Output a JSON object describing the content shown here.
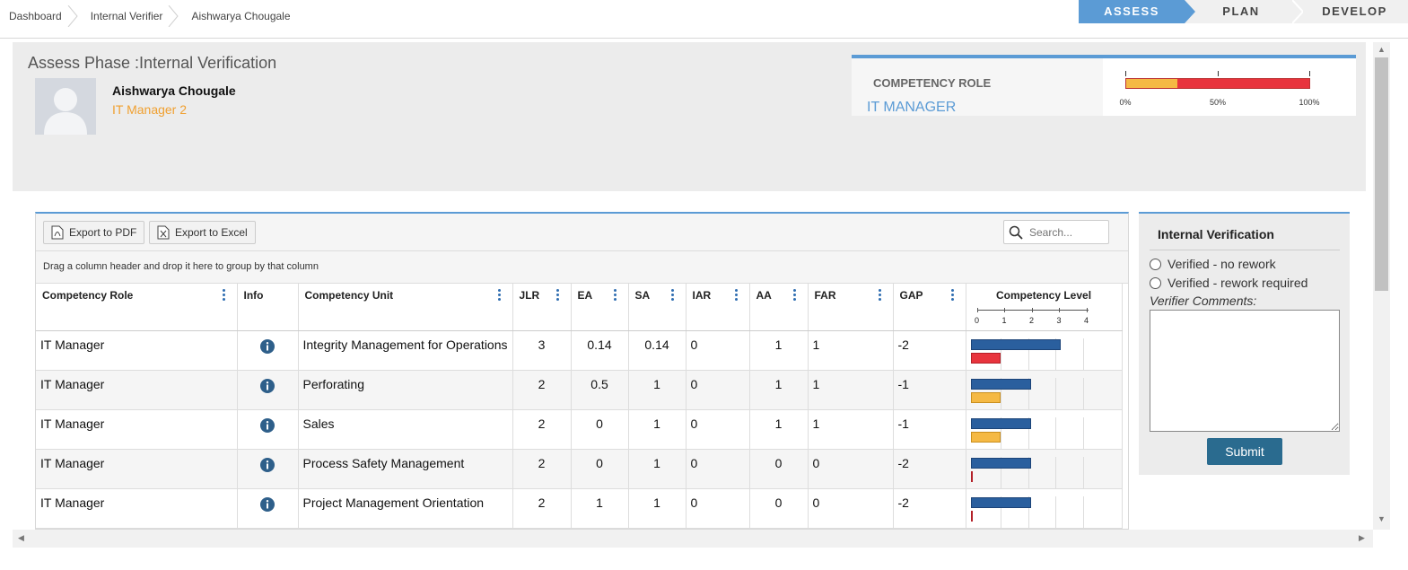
{
  "breadcrumb": [
    "Dashboard",
    "Internal Verifier",
    "Aishwarya Chougale"
  ],
  "phases": [
    {
      "label": "ASSESS",
      "active": true
    },
    {
      "label": "PLAN",
      "active": false
    },
    {
      "label": "DEVELOP",
      "active": false
    }
  ],
  "header": {
    "phase_title": "Assess Phase :Internal Verification",
    "user_name": "Aishwarya Chougale",
    "user_role": "IT Manager 2",
    "avatar_icon": "user-silhouette-icon"
  },
  "competency_card": {
    "label": "COMPETENCY ROLE",
    "value": "IT MANAGER",
    "progress_fraction": 0.28,
    "ticks": [
      "0%",
      "50%",
      "100%"
    ]
  },
  "toolbar": {
    "export_pdf": "Export to PDF",
    "export_excel": "Export to Excel",
    "search_placeholder": "Search..."
  },
  "grouping_hint": "Drag a column header and drop it here to group by that column",
  "columns": [
    "Competency Role",
    "Info",
    "Competency Unit",
    "JLR",
    "EA",
    "SA",
    "IAR",
    "AA",
    "FAR",
    "GAP",
    "Competency Level"
  ],
  "level_scale": [
    "0",
    "1",
    "2",
    "3",
    "4"
  ],
  "rows": [
    {
      "role": "IT Manager",
      "unit": "Integrity Management for Operations",
      "jlr": "3",
      "ea": "0.14",
      "sa": "0.14",
      "iar": "0",
      "aa": "1",
      "far": "1",
      "gap": "-2",
      "level_blue": 3.3,
      "level_sec": 1.1,
      "sec_color": "#e8343d"
    },
    {
      "role": "IT Manager",
      "unit": "Perforating",
      "jlr": "2",
      "ea": "0.5",
      "sa": "1",
      "iar": "0",
      "aa": "1",
      "far": "1",
      "gap": "-1",
      "level_blue": 2.2,
      "level_sec": 1.1,
      "sec_color": "#f5b944"
    },
    {
      "role": "IT Manager",
      "unit": "Sales",
      "jlr": "2",
      "ea": "0",
      "sa": "1",
      "iar": "0",
      "aa": "1",
      "far": "1",
      "gap": "-1",
      "level_blue": 2.2,
      "level_sec": 1.1,
      "sec_color": "#f5b944"
    },
    {
      "role": "IT Manager",
      "unit": "Process Safety Management",
      "jlr": "2",
      "ea": "0",
      "sa": "1",
      "iar": "0",
      "aa": "0",
      "far": "0",
      "gap": "-2",
      "level_blue": 2.2,
      "level_sec": 0.05,
      "sec_color": "#e8343d"
    },
    {
      "role": "IT Manager",
      "unit": "Project Management Orientation",
      "jlr": "2",
      "ea": "1",
      "sa": "1",
      "iar": "0",
      "aa": "0",
      "far": "0",
      "gap": "-2",
      "level_blue": 2.2,
      "level_sec": 0.05,
      "sec_color": "#e8343d"
    }
  ],
  "verification": {
    "title": "Internal Verification",
    "options": [
      "Verified - no rework",
      "Verified - rework required"
    ],
    "comments_label": "Verifier Comments:",
    "comments_value": "",
    "submit": "Submit"
  },
  "colors": {
    "accent": "#5b9bd5",
    "role": "#f0a030",
    "bar_blue": "#2a5f9e",
    "bar_red": "#e8343d",
    "bar_amber": "#f5b944",
    "submit": "#2a6b8f"
  }
}
